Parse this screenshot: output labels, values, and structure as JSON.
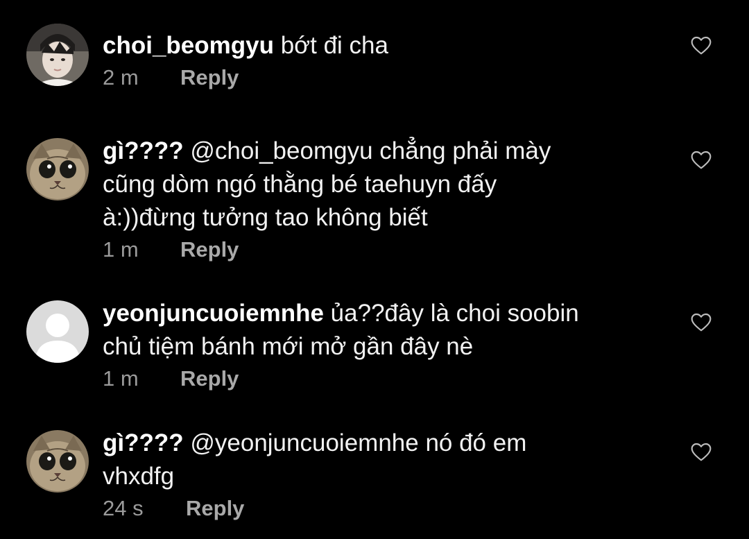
{
  "comments": [
    {
      "username": "choi_beomgyu",
      "text": "bớt đi cha",
      "time": "2 m",
      "reply_label": "Reply",
      "avatar_icon": "person-photo-avatar"
    },
    {
      "username": "gì????",
      "text": "@choi_beomgyu chẳng phải mày\ncũng dòm ngó thằng bé taehuyn đấy\nà:))đừng tưởng tao không biết",
      "time": "1 m",
      "reply_label": "Reply",
      "avatar_icon": "cat-photo-avatar"
    },
    {
      "username": "yeonjuncuoiemnhe",
      "text": "ủa??đây là choi soobin\nchủ tiệm bánh mới mở gần đây nè",
      "time": "1 m",
      "reply_label": "Reply",
      "avatar_icon": "default-user-avatar"
    },
    {
      "username": "gì????",
      "text": "@yeonjuncuoiemnhe nó đó em\nvhxdfg",
      "time": "24 s",
      "reply_label": "Reply",
      "avatar_icon": "cat-photo-avatar"
    }
  ],
  "colors": {
    "background": "#000000",
    "text": "#ffffff",
    "secondary": "#9b9b9b",
    "heart_outline": "#bdbdbd"
  }
}
